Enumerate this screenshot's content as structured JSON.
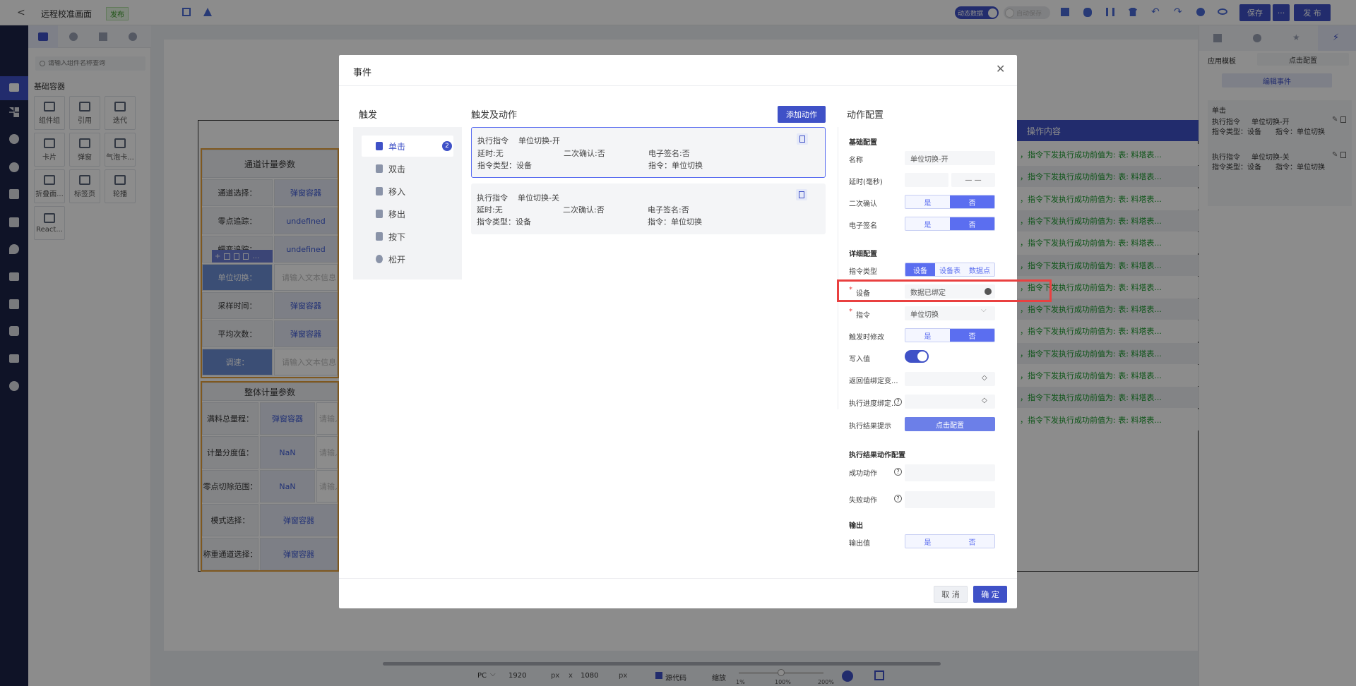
{
  "topbar": {
    "back": "<",
    "title": "远程校准画面",
    "publish_badge": "发布",
    "toggle1_label": "动态数据",
    "toggle2_label": "自动保存",
    "save": "保存",
    "more": "···",
    "publish": "发 布"
  },
  "left_panel": {
    "search_placeholder": "请输入组件名称查询",
    "section_title": "基础容器",
    "tools": [
      "组件组",
      "引用",
      "迭代",
      "卡片",
      "弹窗",
      "气泡卡...",
      "折叠面...",
      "标签页",
      "轮播",
      "React..."
    ]
  },
  "canvas": {
    "panel1_title": "通道计量参数",
    "panel2_title": "整体计量参数",
    "rows1": [
      {
        "label": "通道选择：",
        "value": "弹窗容器"
      },
      {
        "label": "零点追踪：",
        "value": "undefined"
      },
      {
        "label": "蠕变追踪：",
        "value": "undefined"
      },
      {
        "label": "单位切换：",
        "value": "请输入文本信息"
      },
      {
        "label": "采样时间：",
        "value": "弹窗容器"
      },
      {
        "label": "平均次数：",
        "value": "弹窗容器"
      },
      {
        "label": "调速：",
        "value": "请输入文本信息"
      }
    ],
    "rows2": [
      {
        "label": "满料总量程：",
        "value": "弹窗容器",
        "extra": "请输入"
      },
      {
        "label": "计量分度值：",
        "value": "NaN",
        "extra": "请输入"
      },
      {
        "label": "零点切除范围：",
        "value": "NaN",
        "extra": "请输入"
      },
      {
        "label": "模式选择：",
        "value": "弹窗容器"
      },
      {
        "label": "称重通道选择：",
        "value": "弹窗容器"
      }
    ],
    "table_header": "操作内容",
    "table_row_text": "，指令下发执行成功前值为: 表: 料塔表..."
  },
  "right_panel": {
    "app_template": "应用模板",
    "click_config": "点击配置",
    "edit_event": "编辑事件",
    "trigger": "单击",
    "items": [
      {
        "cmd": "执行指令",
        "name": "单位切换-开",
        "type": "指令类型：设备",
        "instr": "指令：单位切换"
      },
      {
        "cmd": "执行指令",
        "name": "单位切换-关",
        "type": "指令类型：设备",
        "instr": "指令：单位切换"
      }
    ]
  },
  "bottombar": {
    "device": "PC",
    "width": "1920",
    "px1": "px",
    "x": "x",
    "height": "1080",
    "px2": "px",
    "source": "源代码",
    "zoom_label": "缩放",
    "zoom_min": "1%",
    "zoom_mid": "100%",
    "zoom_max": "200%",
    "zoom_level": 0.5
  },
  "dialog": {
    "title": "事件",
    "triggers_title": "触发",
    "triggers": [
      "单击",
      "双击",
      "移入",
      "移出",
      "按下",
      "松开"
    ],
    "active_trigger_count": "2",
    "actions_title": "触发及动作",
    "add_action": "添加动作",
    "actions": [
      {
        "cmd": "执行指令",
        "name": "单位切换-开",
        "delay": "延时:无",
        "confirm": "二次确认:否",
        "esign": "电子签名:否",
        "type": "指令类型：设备",
        "instr": "指令：单位切换"
      },
      {
        "cmd": "执行指令",
        "name": "单位切换-关",
        "delay": "延时:无",
        "confirm": "二次确认:否",
        "esign": "电子签名:否",
        "type": "指令类型：设备",
        "instr": "指令：单位切换"
      }
    ],
    "config_title": "动作配置",
    "basic": "基础配置",
    "name_label": "名称",
    "name_value": "单位切换-开",
    "delay_label": "延时(毫秒)",
    "delay_dashes": "—  —",
    "confirm_label": "二次确认",
    "esign_label": "电子签名",
    "yes": "是",
    "no": "否",
    "detail": "详细配置",
    "instr_type_label": "指令类型",
    "instr_types": [
      "设备",
      "设备表",
      "数据点"
    ],
    "device_label": "设备",
    "device_value": "数据已绑定",
    "instr_label": "指令",
    "instr_value": "单位切换",
    "on_trigger_label": "触发时修改",
    "write_label": "写入值",
    "return_label": "返回值绑定变...",
    "progress_label": "执行进度绑定...",
    "result_tip_label": "执行结果提示",
    "result_tip_btn": "点击配置",
    "result_action_title": "执行结果动作配置",
    "success_label": "成功动作",
    "fail_label": "失败动作",
    "output_title": "输出",
    "output_label": "输出值",
    "cancel": "取 消",
    "ok": "确 定"
  },
  "colors": {
    "primary": "#3f51c7",
    "accent": "#5b6ef0",
    "sidebar": "#1c2447",
    "highlight": "#e94040"
  }
}
